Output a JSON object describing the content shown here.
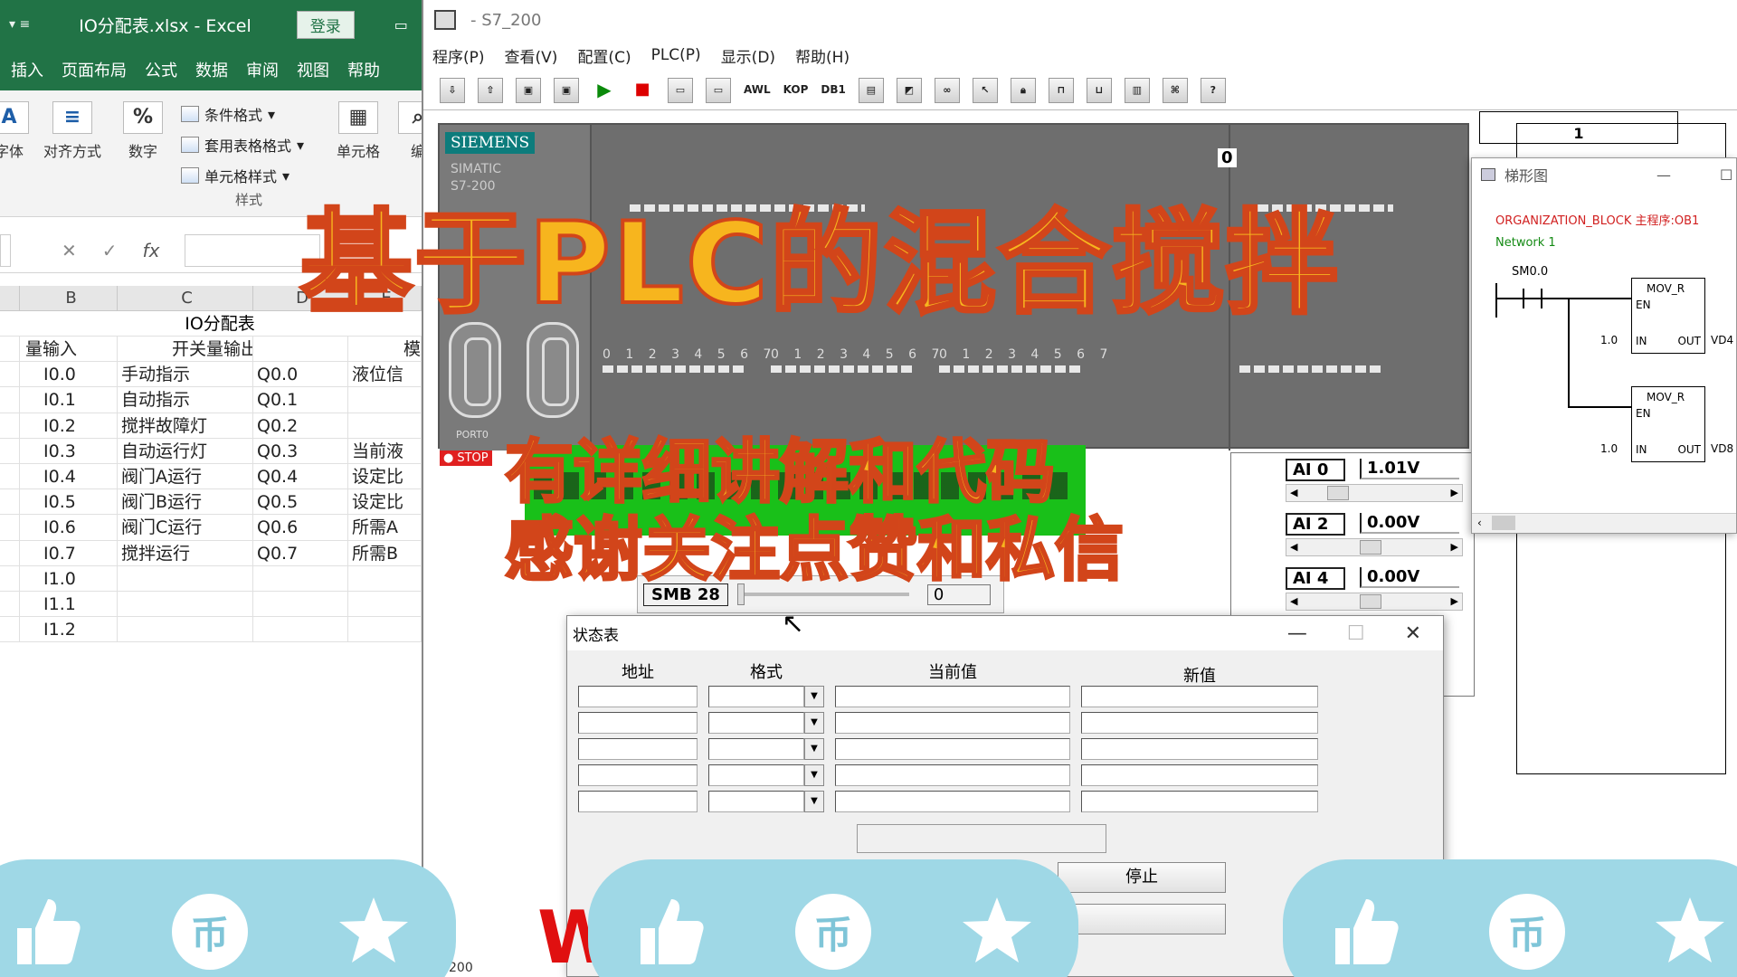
{
  "excel": {
    "title": "IO分配表.xlsx  -  Excel",
    "login": "登录",
    "menu": [
      "插入",
      "页面布局",
      "公式",
      "数据",
      "审阅",
      "视图",
      "帮助"
    ],
    "ribbon": {
      "font": "字体",
      "align": "对齐方式",
      "number": "数字",
      "cond_format": "条件格式",
      "table_format": "套用表格格式",
      "cell_style": "单元格样式",
      "styles_group": "样式",
      "cells": "单元格",
      "edit": "编"
    },
    "columns": [
      "B",
      "C",
      "D",
      "E"
    ],
    "merged_title": "IO分配表",
    "header_row": [
      "量输入",
      "开关量输出",
      "",
      "模"
    ],
    "rows": [
      [
        "I0.0",
        "手动指示",
        "Q0.0",
        "液位信"
      ],
      [
        "I0.1",
        "自动指示",
        "Q0.1",
        ""
      ],
      [
        "I0.2",
        "搅拌故障灯",
        "Q0.2",
        ""
      ],
      [
        "I0.3",
        "自动运行灯",
        "Q0.3",
        "当前液"
      ],
      [
        "I0.4",
        "阀门A运行",
        "Q0.4",
        "设定比"
      ],
      [
        "I0.5",
        "阀门B运行",
        "Q0.5",
        "设定比"
      ],
      [
        "I0.6",
        "阀门C运行",
        "Q0.6",
        "所需A"
      ],
      [
        "I0.7",
        "搅拌运行",
        "Q0.7",
        "所需B"
      ],
      [
        "I1.0",
        "",
        "",
        ""
      ],
      [
        "I1.1",
        "",
        "",
        ""
      ],
      [
        "I1.2",
        "",
        "",
        ""
      ]
    ]
  },
  "sim": {
    "title": "- S7_200",
    "menu": [
      "程序(P)",
      "查看(V)",
      "配置(C)",
      "PLC(P)",
      "显示(D)",
      "帮助(H)"
    ],
    "toolbar_text": [
      "AWL",
      "KOP",
      "DB1"
    ],
    "siemens": "SIEMENS",
    "simatic": "SIMATIC",
    "model": "S7-200",
    "port0": "PORT0",
    "plc_counter": "0",
    "stop": "STOP",
    "io_labels": [
      "0 1 2 3 4 5 6 7",
      "0 1 2 3 4 5 6 7",
      "0 1 2 3 4 5 6 7"
    ],
    "smb": {
      "label": "SMB 28",
      "value": "0"
    },
    "ai": [
      {
        "label": "AI 0",
        "value": "1.01V",
        "thumb": 0.18
      },
      {
        "label": "AI 2",
        "value": "0.00V",
        "thumb": 0.45
      },
      {
        "label": "AI 4",
        "value": "0.00V",
        "thumb": 0.45
      }
    ],
    "box_1": "1",
    "tick_200": "200"
  },
  "ladder": {
    "title": "梯形图",
    "org": "ORGANIZATION_BLOCK 主程序:OB1",
    "network": "Network 1",
    "contact": "SM0.0",
    "block_name": "MOV_R",
    "en": "EN",
    "in": "IN",
    "out": "OUT",
    "in_value": "1.0",
    "outputs": [
      "VD4",
      "VD8"
    ]
  },
  "status_table": {
    "title": "状态表",
    "headers": [
      "地址",
      "格式",
      "当前值",
      "新值"
    ],
    "row_count": 5,
    "stop_button": "停止"
  },
  "overlay": {
    "title": "基于PLC的混合搅拌",
    "line1": "有详细讲解和代码",
    "line2": "感谢关注点赞和私信",
    "bottom_red": "W"
  },
  "colors": {
    "excel_green": "#217346",
    "overlay_fill": "#f7b51e",
    "overlay_stroke": "#d2451a",
    "bubble": "#9fd8e6",
    "terminal_green": "#19c019"
  },
  "icons": {
    "like": "thumbs-up-icon",
    "coin": "coin-icon",
    "favorite": "star-icon"
  }
}
